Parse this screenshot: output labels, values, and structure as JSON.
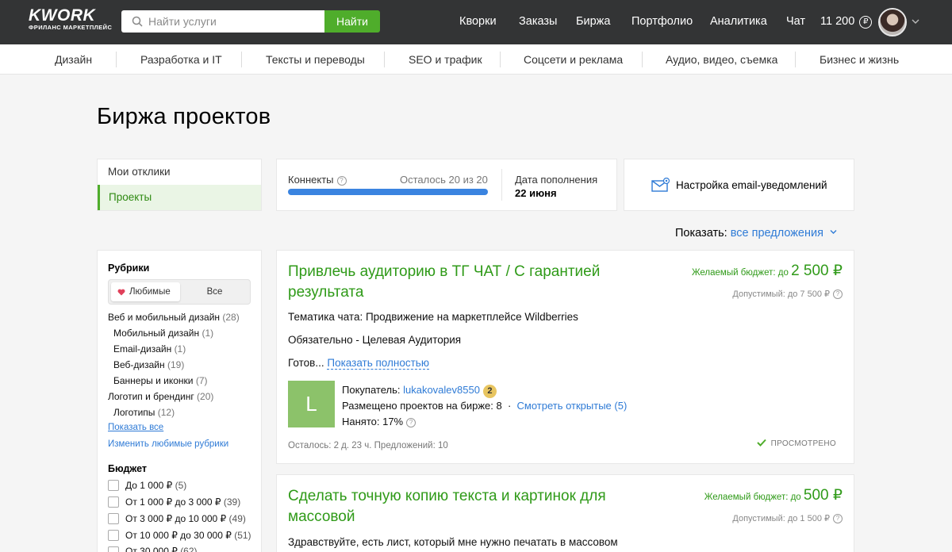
{
  "header": {
    "logo_main": "KWORK",
    "logo_sub": "ФРИЛАНС МАРКЕТПЛЕЙС",
    "search_placeholder": "Найти услуги",
    "search_button": "Найти",
    "nav": [
      "Кворки",
      "Заказы",
      "Биржа",
      "Портфолио",
      "Аналитика",
      "Чат"
    ],
    "balance": "11 200",
    "currency_symbol": "₽"
  },
  "categories": [
    "Дизайн",
    "Разработка и IT",
    "Тексты и переводы",
    "SEO и трафик",
    "Соцсети и реклама",
    "Аудио, видео, съемка",
    "Бизнес и жизнь"
  ],
  "page_title": "Биржа проектов",
  "left_menu": [
    {
      "label": "Мои отклики",
      "active": false
    },
    {
      "label": "Проекты",
      "active": true
    }
  ],
  "connects": {
    "label": "Коннекты",
    "remaining": "Осталось  20 из 20",
    "progress_fraction": 1.0,
    "refill_label": "Дата пополнения",
    "refill_date": "22 июня"
  },
  "notifications": {
    "label": "Настройка email-уведомлений"
  },
  "show": {
    "label": "Показать:",
    "value": "все предложения"
  },
  "filters": {
    "rubrics_title": "Рубрики",
    "toggle": {
      "on": "Любимые",
      "off": "Все"
    },
    "rubrics": [
      {
        "label": "Веб и мобильный дизайн",
        "count": "(28)",
        "level": 0
      },
      {
        "label": "Мобильный дизайн",
        "count": "(1)",
        "level": 1
      },
      {
        "label": "Email-дизайн",
        "count": "(1)",
        "level": 1
      },
      {
        "label": "Веб-дизайн",
        "count": "(19)",
        "level": 1
      },
      {
        "label": "Баннеры и иконки",
        "count": "(7)",
        "level": 1
      },
      {
        "label": "Логотип и брендинг",
        "count": "(20)",
        "level": 0
      },
      {
        "label": "Логотипы",
        "count": "(12)",
        "level": 1
      }
    ],
    "show_all": "Показать все",
    "edit_favorites": "Изменить любимые рубрики",
    "budget_title": "Бюджет",
    "budget": [
      {
        "label": "До 1 000 ₽",
        "count": "(5)"
      },
      {
        "label": "От 1 000 ₽ до 3 000 ₽",
        "count": "(39)"
      },
      {
        "label": "От 3 000 ₽ до 10 000 ₽",
        "count": "(49)"
      },
      {
        "label": "От 10 000 ₽ до 30 000 ₽",
        "count": "(51)"
      },
      {
        "label": "От 30 000 ₽",
        "count": "(62)"
      }
    ]
  },
  "projects": [
    {
      "title": "Привлечь аудиторию в ТГ ЧАТ / С гарантией результата",
      "budget_label": "Желаемый бюджет: до",
      "budget_value": "2 500 ₽",
      "allowed": "Допустимый: до 7 500 ₽",
      "lines": [
        "Тематика чата: Продвижение на маркетплейсе Wildberries",
        "Обязательно - Целевая Аудитория"
      ],
      "truncated": "Готов...",
      "more": "Показать полностью",
      "buyer_initial": "L",
      "buyer_label": "Покупатель:",
      "buyer_name": "lukakovalev8550",
      "buyer_badge": "2",
      "posted_label": "Размещено проектов на бирже: 8",
      "open_link": "Смотреть открытые (5)",
      "hired": "Нанято: 17%",
      "meta": "Осталось: 2 д. 23 ч.   Предложений: 10",
      "viewed": "ПРОСМОТРЕНО"
    },
    {
      "title": "Сделать точную копию текста и картинок для массовой",
      "budget_label": "Желаемый бюджет: до",
      "budget_value": "500 ₽",
      "allowed": "Допустимый: до 1 500 ₽",
      "lines": [
        "Здравствуйте, есть лист, который мне нужно печатать в массовом"
      ]
    }
  ],
  "colors": {
    "brand_green": "#4fad2b",
    "link_blue": "#2f7bd6",
    "header_bg": "#333435"
  }
}
